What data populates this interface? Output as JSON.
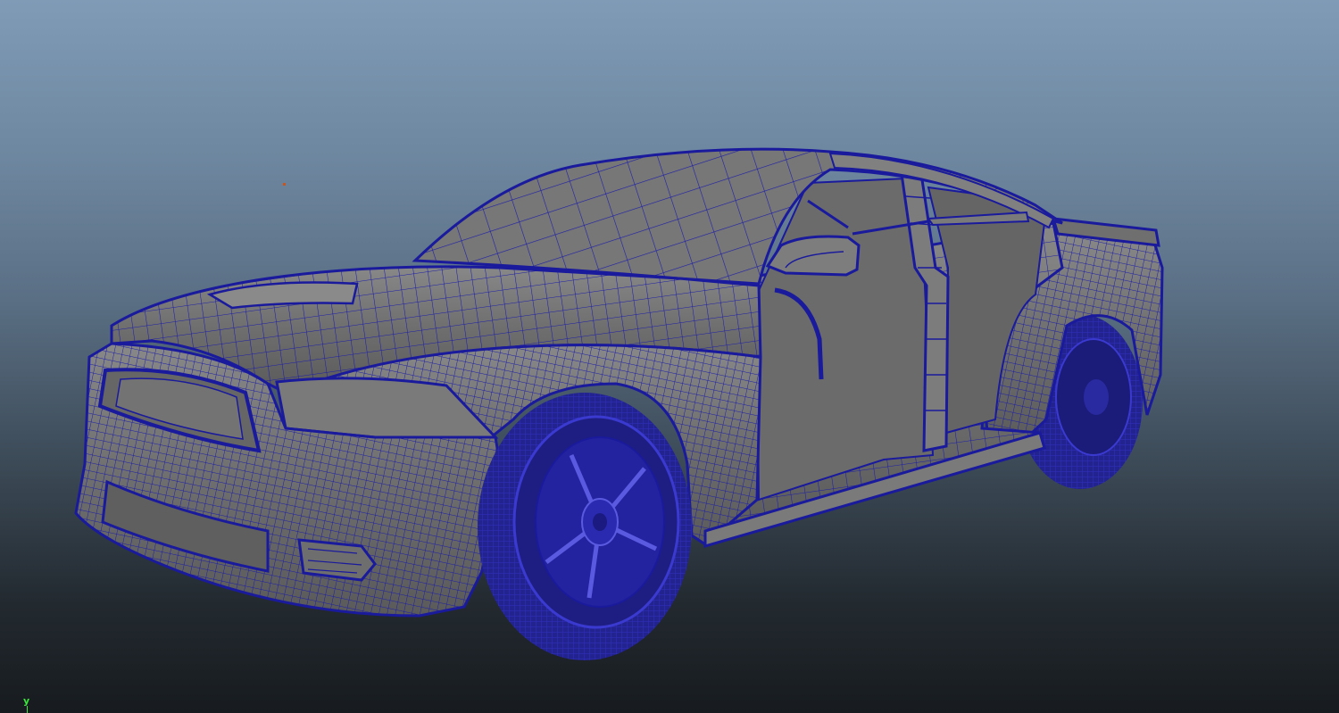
{
  "viewport": {
    "axis_label": "y",
    "colors": {
      "wireframe": "#1a1a9c",
      "surface": "#6a6a6a",
      "surface_light": "#838383",
      "surface_dark": "#4e4e4e",
      "tire": "#23238f",
      "axis": "#39e639",
      "pivot": "#c7551d"
    }
  }
}
